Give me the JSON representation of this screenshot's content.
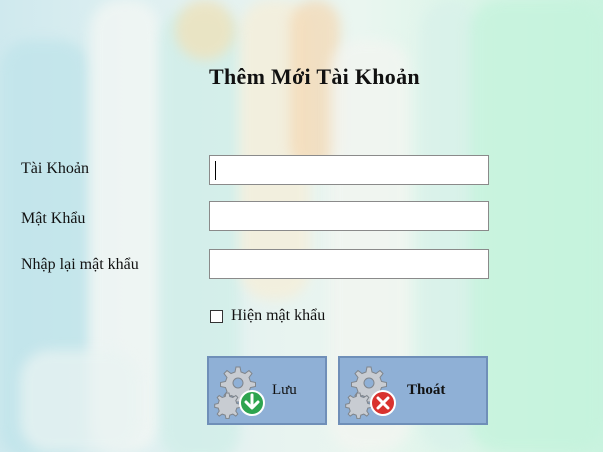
{
  "window": {
    "title": "Thêm Mới Tài Khoản"
  },
  "form": {
    "username_label": "Tài Khoản",
    "password_label": "Mật Khẩu",
    "confirm_label": "Nhập lại mật khẩu",
    "username_value": "",
    "password_value": "",
    "confirm_value": "",
    "show_password_label": "Hiện mật khẩu",
    "show_password_checked": false
  },
  "buttons": {
    "save_label": "Lưu",
    "exit_label": "Thoát"
  },
  "icons": {
    "save": "gear-save-icon",
    "exit": "gear-exit-icon",
    "save_badge_color": "#2ea44f",
    "exit_badge_color": "#d9322e"
  }
}
